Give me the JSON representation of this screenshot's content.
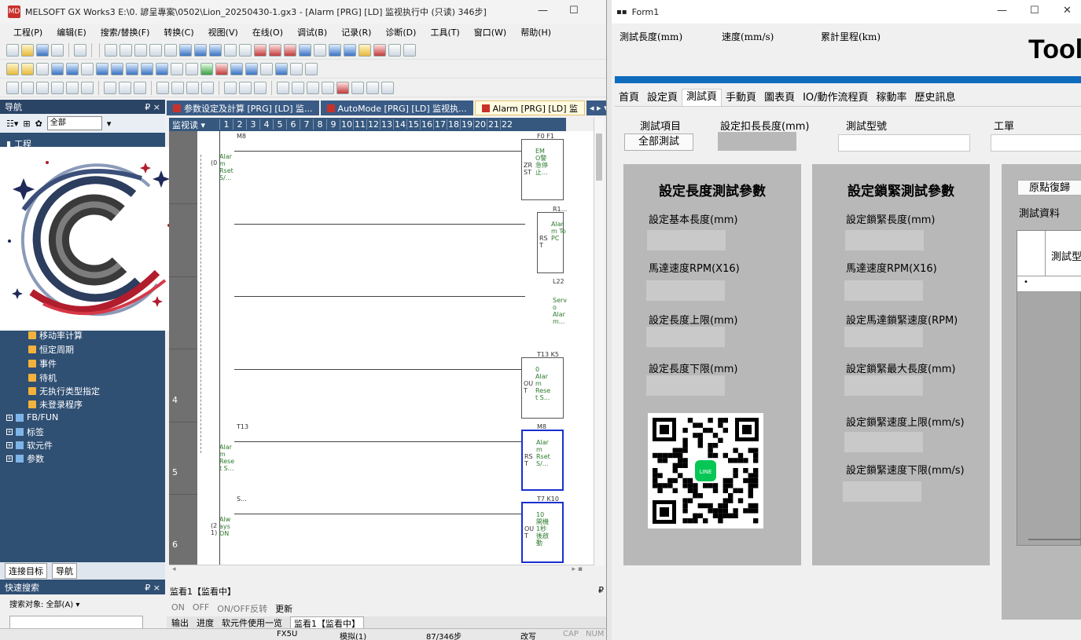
{
  "gx": {
    "title": "MELSOFT GX Works3 E:\\0. 諺呈專案\\0502\\Lion_20250430-1.gx3 - [Alarm [PRG] [LD] 监视执行中 (只读) 346步]",
    "app_icon": "MD",
    "menu": [
      "工程(P)",
      "编辑(E)",
      "搜索/替换(F)",
      "转换(C)",
      "视图(V)",
      "在线(O)",
      "调试(B)",
      "记录(R)",
      "诊断(D)",
      "工具(T)",
      "窗口(W)",
      "帮助(H)"
    ],
    "nav": {
      "title": "导航",
      "pin": "₽ ×",
      "filter": "全部",
      "root": "工程",
      "items": [
        "移动率计算",
        "恒定周期",
        "事件",
        "待机",
        "无执行类型指定",
        "未登录程序"
      ],
      "roots": [
        "FB/FUN",
        "标签",
        "软元件",
        "参数"
      ],
      "tabs": [
        "连接目标",
        "导航"
      ]
    },
    "quick_search": {
      "title": "快速搜索",
      "pin": "₽ ×",
      "target": "搜索对象: 全部(A) ▾"
    },
    "editor_tabs": [
      "参数设定及計算 [PRG] [LD] 监...",
      "AutoMode [PRG] [LD] 监视执...",
      "Alarm [PRG] [LD] 监"
    ],
    "col_header_label": "监视读 ▾",
    "columns": [
      "1",
      "2",
      "3",
      "4",
      "5",
      "6",
      "7",
      "8",
      "9",
      "10",
      "11",
      "12",
      "13",
      "14",
      "15",
      "16",
      "17",
      "18",
      "19",
      "20",
      "21",
      "22"
    ],
    "rows": [
      {
        "num": "",
        "contact": "M8",
        "side": "(0",
        "contact_label": "Alar m Rset S/...",
        "coil_inst": "ZR ST",
        "coil_dev": "F0  F1",
        "coil_label": "EM O警 急停 止..."
      },
      {
        "num": "",
        "coil_inst": "RS T",
        "coil_dev": "R1...",
        "coil_label": "Alar m To PC"
      },
      {
        "num": "",
        "coil_dev": "L22",
        "coil_label": "Serv o Alar m..."
      },
      {
        "num": "4",
        "coil_inst": "OU T",
        "coil_dev": "T13  K5",
        "coil_label": "0 Alar m Rese t S..."
      },
      {
        "num": "5",
        "contact": "T13",
        "contact_label": "Alar m Rese t S...",
        "coil_inst": "RS T",
        "coil_dev": "M8",
        "coil_label": "Alar m Rset S/..."
      },
      {
        "num": "6",
        "contact": "S...",
        "side": "(2 1)",
        "contact_label": "Alw ays ON",
        "coil_inst": "OU T",
        "coil_dev": "T7  K10",
        "coil_label": "10 開機 1秒 後啟 動"
      }
    ],
    "watch": {
      "title": "监看1【监看中】",
      "toolbar": [
        "ON",
        "OFF",
        "ON/OFF反转",
        "更新"
      ],
      "tabs": [
        "输出",
        "进度",
        "软元件使用一览",
        "监看1【监看中】"
      ]
    },
    "status": [
      "FX5U",
      "模拟(1)",
      "87/346步",
      "改写",
      "CAP",
      "NUM"
    ]
  },
  "form": {
    "title": "Form1",
    "top_labels": [
      "測試長度(mm)",
      "速度(mm/s)",
      "累計里程(km)"
    ],
    "big_title": "Tool",
    "tabs": [
      "首頁",
      "設定頁",
      "測試頁",
      "手動頁",
      "圖表頁",
      "IO/動作流程頁",
      "稼動率",
      "歷史訊息"
    ],
    "active_tab": "測試頁",
    "test_item_label": "測試項目",
    "test_all_btn": "全部測試",
    "clamp_len_label": "設定扣長長度(mm)",
    "model_label": "測試型號",
    "order_label": "工單",
    "panel1": {
      "title": "設定長度測試參數",
      "fields": [
        "設定基本長度(mm)",
        "馬達速度RPM(X16)",
        "設定長度上限(mm)",
        "設定長度下限(mm)"
      ]
    },
    "panel2": {
      "title": "設定鎖緊測試參數",
      "fields": [
        "設定鎖緊長度(mm)",
        "馬達速度RPM(X16)",
        "設定馬達鎖緊速度(RPM)",
        "設定鎖緊最大長度(mm)",
        "設定鎖緊速度上限(mm/s)",
        "設定鎖緊速度下限(mm/s)"
      ]
    },
    "home_btn": "原點復歸",
    "test_data_label": "測試資料",
    "grid_header": "測試型",
    "grid_row_marker": "•",
    "qr_center": "LINE"
  },
  "colors": {
    "accent_blue": "#0f6cbd",
    "nav_bg": "#2f4f73",
    "panel_gray": "#b8b8b8",
    "select_blue": "#1a2fcf",
    "ladder_green": "#2b7a2b"
  }
}
